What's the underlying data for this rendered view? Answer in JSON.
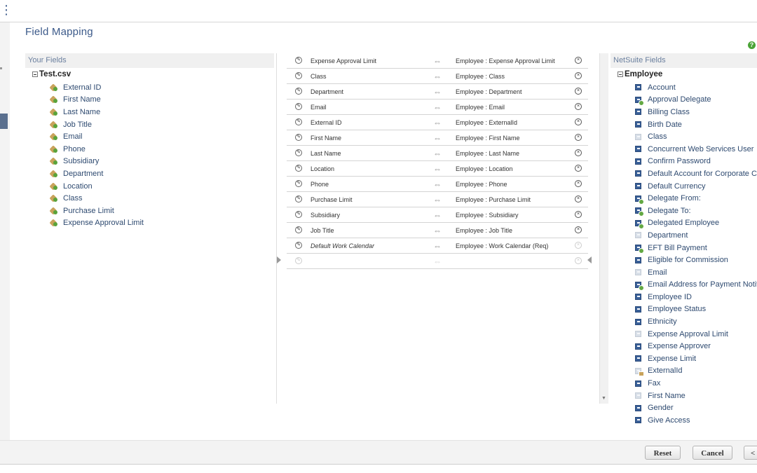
{
  "page": {
    "title": "Field Mapping",
    "help_glyph": "?"
  },
  "your_fields": {
    "header": "Your Fields",
    "root": "Test.csv",
    "items": [
      "External ID",
      "First Name",
      "Last Name",
      "Job Title",
      "Email",
      "Phone",
      "Subsidiary",
      "Department",
      "Location",
      "Class",
      "Purchase Limit",
      "Expense Approval Limit"
    ]
  },
  "mappings": {
    "arrow_glyph": "⇔",
    "edit_glyph": "✎",
    "delete_glyph": "×",
    "rows": [
      {
        "source": "Expense Approval Limit",
        "target": "Employee : Expense Approval Limit"
      },
      {
        "source": "Class",
        "target": "Employee : Class"
      },
      {
        "source": "Department",
        "target": "Employee : Department"
      },
      {
        "source": "Email",
        "target": "Employee : Email"
      },
      {
        "source": "External ID",
        "target": "Employee : ExternalId"
      },
      {
        "source": "First Name",
        "target": "Employee : First Name"
      },
      {
        "source": "Last Name",
        "target": "Employee : Last Name"
      },
      {
        "source": "Location",
        "target": "Employee : Location"
      },
      {
        "source": "Phone",
        "target": "Employee : Phone"
      },
      {
        "source": "Purchase Limit",
        "target": "Employee : Purchase Limit"
      },
      {
        "source": "Subsidiary",
        "target": "Employee : Subsidiary"
      },
      {
        "source": "Job Title",
        "target": "Employee : Job Title"
      },
      {
        "source": "Default Work Calendar",
        "target": "Employee : Work Calendar (Req)"
      },
      {
        "source": "",
        "target": ""
      }
    ]
  },
  "netsuite_fields": {
    "header": "NetSuite Fields",
    "root": "Employee",
    "items": [
      {
        "label": "Account",
        "icon": "field-icon"
      },
      {
        "label": "Approval Delegate",
        "icon": "field-add-icon"
      },
      {
        "label": "Billing Class",
        "icon": "field-icon"
      },
      {
        "label": "Birth Date",
        "icon": "field-icon"
      },
      {
        "label": "Class",
        "icon": "field-mapped-icon"
      },
      {
        "label": "Concurrent Web Services User",
        "icon": "field-icon"
      },
      {
        "label": "Confirm Password",
        "icon": "field-icon"
      },
      {
        "label": "Default Account for Corporate Card Expenses",
        "icon": "field-icon"
      },
      {
        "label": "Default Currency",
        "icon": "field-icon"
      },
      {
        "label": "Delegate From:",
        "icon": "field-add-icon"
      },
      {
        "label": "Delegate To:",
        "icon": "field-add-icon"
      },
      {
        "label": "Delegated Employee",
        "icon": "field-add-icon"
      },
      {
        "label": "Department",
        "icon": "field-mapped-icon"
      },
      {
        "label": "EFT Bill Payment",
        "icon": "field-add-icon"
      },
      {
        "label": "Eligible for Commission",
        "icon": "field-icon"
      },
      {
        "label": "Email",
        "icon": "field-mapped-icon"
      },
      {
        "label": "Email Address for Payment Notification",
        "icon": "field-add-icon"
      },
      {
        "label": "Employee ID",
        "icon": "field-icon"
      },
      {
        "label": "Employee Status",
        "icon": "field-icon"
      },
      {
        "label": "Ethnicity",
        "icon": "field-icon"
      },
      {
        "label": "Expense Approval Limit",
        "icon": "field-mapped-icon"
      },
      {
        "label": "Expense Approver",
        "icon": "field-icon"
      },
      {
        "label": "Expense Limit",
        "icon": "field-icon"
      },
      {
        "label": "ExternalId",
        "icon": "field-key-icon"
      },
      {
        "label": "Fax",
        "icon": "field-icon"
      },
      {
        "label": "First Name",
        "icon": "field-mapped-icon"
      },
      {
        "label": "Gender",
        "icon": "field-icon"
      },
      {
        "label": "Give Access",
        "icon": "field-icon"
      }
    ]
  },
  "footer": {
    "reset": "Reset",
    "cancel": "Cancel",
    "back": "<"
  }
}
